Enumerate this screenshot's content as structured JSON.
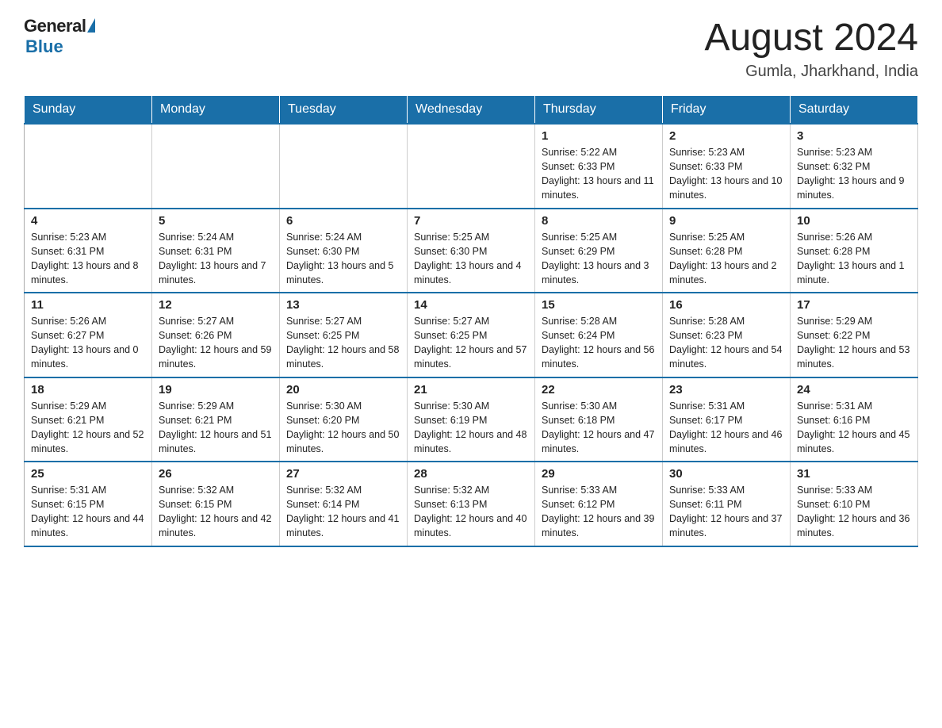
{
  "logo": {
    "general": "General",
    "blue": "Blue"
  },
  "title": "August 2024",
  "subtitle": "Gumla, Jharkhand, India",
  "weekdays": [
    "Sunday",
    "Monday",
    "Tuesday",
    "Wednesday",
    "Thursday",
    "Friday",
    "Saturday"
  ],
  "weeks": [
    [
      {
        "day": "",
        "info": ""
      },
      {
        "day": "",
        "info": ""
      },
      {
        "day": "",
        "info": ""
      },
      {
        "day": "",
        "info": ""
      },
      {
        "day": "1",
        "info": "Sunrise: 5:22 AM\nSunset: 6:33 PM\nDaylight: 13 hours and 11 minutes."
      },
      {
        "day": "2",
        "info": "Sunrise: 5:23 AM\nSunset: 6:33 PM\nDaylight: 13 hours and 10 minutes."
      },
      {
        "day": "3",
        "info": "Sunrise: 5:23 AM\nSunset: 6:32 PM\nDaylight: 13 hours and 9 minutes."
      }
    ],
    [
      {
        "day": "4",
        "info": "Sunrise: 5:23 AM\nSunset: 6:31 PM\nDaylight: 13 hours and 8 minutes."
      },
      {
        "day": "5",
        "info": "Sunrise: 5:24 AM\nSunset: 6:31 PM\nDaylight: 13 hours and 7 minutes."
      },
      {
        "day": "6",
        "info": "Sunrise: 5:24 AM\nSunset: 6:30 PM\nDaylight: 13 hours and 5 minutes."
      },
      {
        "day": "7",
        "info": "Sunrise: 5:25 AM\nSunset: 6:30 PM\nDaylight: 13 hours and 4 minutes."
      },
      {
        "day": "8",
        "info": "Sunrise: 5:25 AM\nSunset: 6:29 PM\nDaylight: 13 hours and 3 minutes."
      },
      {
        "day": "9",
        "info": "Sunrise: 5:25 AM\nSunset: 6:28 PM\nDaylight: 13 hours and 2 minutes."
      },
      {
        "day": "10",
        "info": "Sunrise: 5:26 AM\nSunset: 6:28 PM\nDaylight: 13 hours and 1 minute."
      }
    ],
    [
      {
        "day": "11",
        "info": "Sunrise: 5:26 AM\nSunset: 6:27 PM\nDaylight: 13 hours and 0 minutes."
      },
      {
        "day": "12",
        "info": "Sunrise: 5:27 AM\nSunset: 6:26 PM\nDaylight: 12 hours and 59 minutes."
      },
      {
        "day": "13",
        "info": "Sunrise: 5:27 AM\nSunset: 6:25 PM\nDaylight: 12 hours and 58 minutes."
      },
      {
        "day": "14",
        "info": "Sunrise: 5:27 AM\nSunset: 6:25 PM\nDaylight: 12 hours and 57 minutes."
      },
      {
        "day": "15",
        "info": "Sunrise: 5:28 AM\nSunset: 6:24 PM\nDaylight: 12 hours and 56 minutes."
      },
      {
        "day": "16",
        "info": "Sunrise: 5:28 AM\nSunset: 6:23 PM\nDaylight: 12 hours and 54 minutes."
      },
      {
        "day": "17",
        "info": "Sunrise: 5:29 AM\nSunset: 6:22 PM\nDaylight: 12 hours and 53 minutes."
      }
    ],
    [
      {
        "day": "18",
        "info": "Sunrise: 5:29 AM\nSunset: 6:21 PM\nDaylight: 12 hours and 52 minutes."
      },
      {
        "day": "19",
        "info": "Sunrise: 5:29 AM\nSunset: 6:21 PM\nDaylight: 12 hours and 51 minutes."
      },
      {
        "day": "20",
        "info": "Sunrise: 5:30 AM\nSunset: 6:20 PM\nDaylight: 12 hours and 50 minutes."
      },
      {
        "day": "21",
        "info": "Sunrise: 5:30 AM\nSunset: 6:19 PM\nDaylight: 12 hours and 48 minutes."
      },
      {
        "day": "22",
        "info": "Sunrise: 5:30 AM\nSunset: 6:18 PM\nDaylight: 12 hours and 47 minutes."
      },
      {
        "day": "23",
        "info": "Sunrise: 5:31 AM\nSunset: 6:17 PM\nDaylight: 12 hours and 46 minutes."
      },
      {
        "day": "24",
        "info": "Sunrise: 5:31 AM\nSunset: 6:16 PM\nDaylight: 12 hours and 45 minutes."
      }
    ],
    [
      {
        "day": "25",
        "info": "Sunrise: 5:31 AM\nSunset: 6:15 PM\nDaylight: 12 hours and 44 minutes."
      },
      {
        "day": "26",
        "info": "Sunrise: 5:32 AM\nSunset: 6:15 PM\nDaylight: 12 hours and 42 minutes."
      },
      {
        "day": "27",
        "info": "Sunrise: 5:32 AM\nSunset: 6:14 PM\nDaylight: 12 hours and 41 minutes."
      },
      {
        "day": "28",
        "info": "Sunrise: 5:32 AM\nSunset: 6:13 PM\nDaylight: 12 hours and 40 minutes."
      },
      {
        "day": "29",
        "info": "Sunrise: 5:33 AM\nSunset: 6:12 PM\nDaylight: 12 hours and 39 minutes."
      },
      {
        "day": "30",
        "info": "Sunrise: 5:33 AM\nSunset: 6:11 PM\nDaylight: 12 hours and 37 minutes."
      },
      {
        "day": "31",
        "info": "Sunrise: 5:33 AM\nSunset: 6:10 PM\nDaylight: 12 hours and 36 minutes."
      }
    ]
  ]
}
